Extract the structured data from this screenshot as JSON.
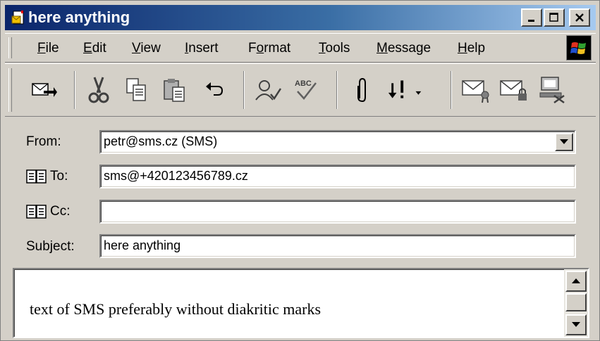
{
  "window": {
    "title": "here anything",
    "controls": {
      "minimize": "minimize",
      "maximize": "maximize",
      "close": "close"
    }
  },
  "menu": [
    {
      "pre": "",
      "key": "F",
      "post": "ile"
    },
    {
      "pre": "",
      "key": "E",
      "post": "dit"
    },
    {
      "pre": "",
      "key": "V",
      "post": "iew"
    },
    {
      "pre": "",
      "key": "I",
      "post": "nsert"
    },
    {
      "pre": "F",
      "key": "o",
      "post": "rmat"
    },
    {
      "pre": "",
      "key": "T",
      "post": "ools"
    },
    {
      "pre": "",
      "key": "M",
      "post": "essage"
    },
    {
      "pre": "",
      "key": "H",
      "post": "elp"
    }
  ],
  "toolbar": {
    "icons": [
      "send-icon",
      "cut-icon",
      "copy-icon",
      "paste-icon",
      "undo-icon",
      "check-names-icon",
      "spelling-icon",
      "attach-icon",
      "priority-icon",
      "sign-icon",
      "encrypt-icon",
      "offline-icon"
    ]
  },
  "fields": {
    "from_label": "From:",
    "from_value": "petr@sms.cz  (SMS)",
    "to_label": "To:",
    "to_value": "sms@+420123456789.cz",
    "cc_label": "Cc:",
    "cc_value": "",
    "subject_label": "Subject:",
    "subject_value": "here anything"
  },
  "body": {
    "text": "text of SMS preferably without diakritic marks"
  },
  "colors": {
    "titlebar_start": "#0a246a",
    "titlebar_end": "#a6caf0",
    "face": "#d4d0c8"
  }
}
